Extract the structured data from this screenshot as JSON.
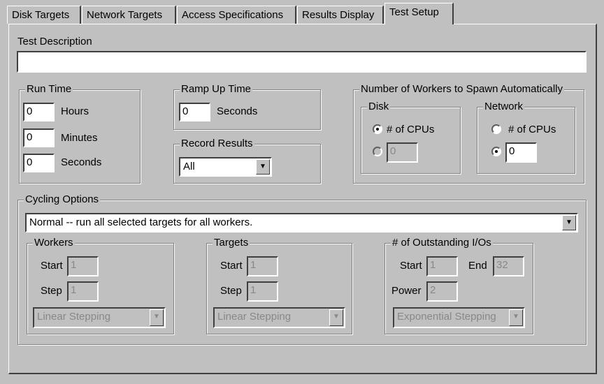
{
  "tabs": [
    "Disk Targets",
    "Network Targets",
    "Access Specifications",
    "Results Display",
    "Test Setup"
  ],
  "active_tab": "Test Setup",
  "test_description": {
    "label": "Test Description",
    "value": ""
  },
  "run_time": {
    "label": "Run Time",
    "hours": "0",
    "hours_label": "Hours",
    "minutes": "0",
    "minutes_label": "Minutes",
    "seconds": "0",
    "seconds_label": "Seconds"
  },
  "ramp_up": {
    "label": "Ramp Up Time",
    "value": "0",
    "unit": "Seconds"
  },
  "record_results": {
    "label": "Record Results",
    "value": "All"
  },
  "workers_spawn": {
    "label": "Number of Workers to Spawn Automatically",
    "disk": {
      "label": "Disk",
      "cpus_label": "# of CPUs",
      "cpus_selected": true,
      "count": "0"
    },
    "network": {
      "label": "Network",
      "cpus_label": "# of CPUs",
      "cpus_selected": false,
      "count": "0"
    }
  },
  "cycling": {
    "label": "Cycling Options",
    "mode": "Normal -- run all selected targets for all workers.",
    "workers": {
      "label": "Workers",
      "start_label": "Start",
      "start": "1",
      "step_label": "Step",
      "step": "1",
      "stepping": "Linear Stepping"
    },
    "targets": {
      "label": "Targets",
      "start_label": "Start",
      "start": "1",
      "step_label": "Step",
      "step": "1",
      "stepping": "Linear Stepping"
    },
    "outstanding": {
      "label": "# of Outstanding I/Os",
      "start_label": "Start",
      "start": "1",
      "end_label": "End",
      "end": "32",
      "power_label": "Power",
      "power": "2",
      "stepping": "Exponential Stepping"
    }
  },
  "icons": {
    "dropdown": "chevron-down-icon",
    "radio": "radio-icon"
  }
}
